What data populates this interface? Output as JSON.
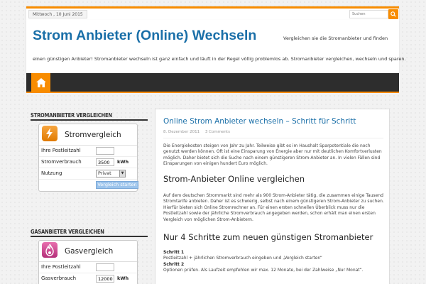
{
  "topbar": {
    "date": "Mittwoch , 10 Juni 2015",
    "search_placeholder": "Suchen"
  },
  "header": {
    "title": "Strom Anbieter (Online) Wechseln",
    "tagline_part1": "Vergleichen sie die Stromanbieter und finden",
    "tagline_part2": "einen günstigen Anbieter! Stromanbieter wechseln ist ganz einfach und läuft in der Regel völlig problemlos ab. Stromanbieter vergleichen, wechseln und sparen."
  },
  "nav": {
    "home_icon": "home-icon"
  },
  "sidebar": {
    "strom": {
      "section_title": "STROMANBIETER VERGLEICHEN",
      "widget_title": "Stromvergleich",
      "icon": "lightning-icon",
      "labels": [
        "Ihre Postleitzahl",
        "Stromverbrauch",
        "Nutzung"
      ],
      "plz_value": "",
      "verbrauch_value": "3500",
      "unit": "kWh",
      "nutzung_value": "Privat",
      "submit": "Vergleich starten"
    },
    "gas": {
      "section_title": "GASANBIETER VERGLEICHEN",
      "widget_title": "Gasvergleich",
      "icon": "flame-icon",
      "labels": [
        "Ihre Postleitzahl",
        "Gasverbrauch"
      ],
      "plz_value": "",
      "verbrauch_value": "12000",
      "unit": "kWh"
    }
  },
  "post": {
    "title": "Online Strom Anbieter wechseln – Schritt für Schritt",
    "date": "8. Dezember 2011",
    "comments": "3 Comments",
    "intro": "Die Energiekosten steigen von Jahr zu Jahr. Teilweise gibt es im Haushalt Sparpotentiale die noch genutzt werden können. Oft ist eine Einsparung von Energie aber nur mit deutlichen Komfortverlusten möglich. Daher bietet sich die Suche nach einem günstigeren Strom-Anbieter an. In vielen Fällen sind Einsparungen von einigen hundert Euro möglich.",
    "h2_1": "Strom-Anbieter Online vergleichen",
    "para2": "Auf dem deutschen Strommarkt sind mehr als 900 Strom-Anbieter tätig, die zusammen einige Tausend Stromtarife anbieten. Daher ist es schwierig, selbst nach einem günstigeren Strom-Anbieter zu suchen. Hierfür bieten sich Online Stromrechner an. Für einen ersten schnellen Überblick muss nur die Postleitzahl sowie der jährliche Stromverbrauch angegeben werden, schon erhält man einen ersten Vergleich von möglichen Strom-Anbietern.",
    "h2_2": "Nur 4 Schritte zum neuen günstigen Stromanbieter",
    "step1_label": "Schritt 1",
    "step1_text": "Postleitzahl + jährlichen Stromverbrauch eingeben und „Vergleich starten“",
    "step2_label": "Schritt 2",
    "step2_text": "Optionen prüfen. Als Laufzeit empfehlen wir max. 12 Monate, bei der Zahlweise „Nur Monat“."
  }
}
